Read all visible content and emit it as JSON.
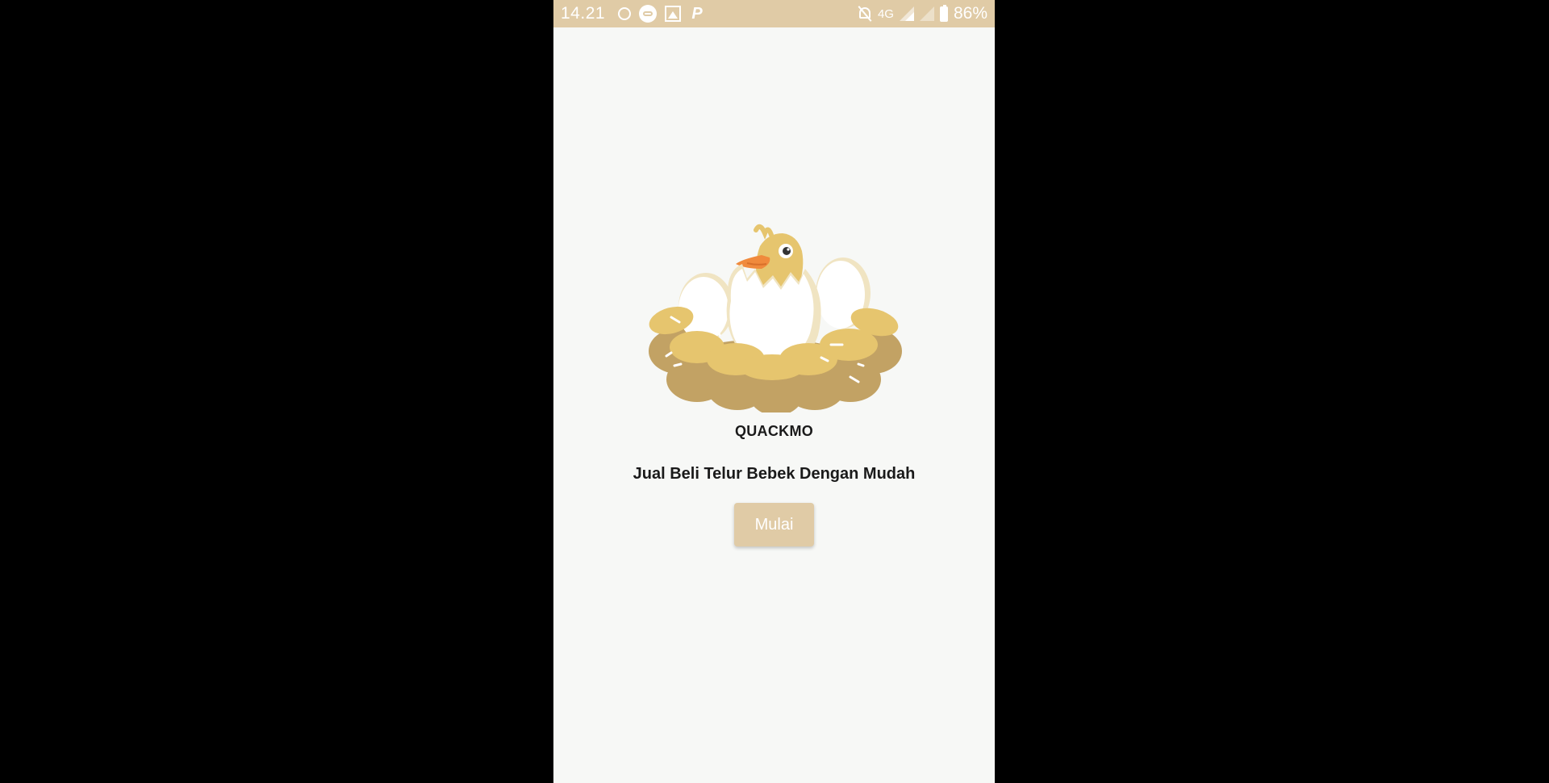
{
  "status_bar": {
    "time": "14.21",
    "network": "4G",
    "battery": "86%",
    "background_color": "#e0cba6",
    "left_icons": [
      "circle-notification-icon",
      "chat-bubble-icon",
      "gallery-icon",
      "p-app-icon"
    ],
    "right_icons": [
      "bell-off-icon",
      "signal-icon",
      "signal-empty-icon",
      "battery-charging-icon"
    ]
  },
  "main": {
    "illustration": "duckling-hatching-nest-illustration",
    "title": "QUACKMO",
    "tagline": "Jual Beli Telur Bebek Dengan Mudah",
    "start_button_label": "Mulai"
  },
  "colors": {
    "accent": "#e0cba6",
    "background": "#f7f8f6",
    "text": "#1a1a1a"
  }
}
